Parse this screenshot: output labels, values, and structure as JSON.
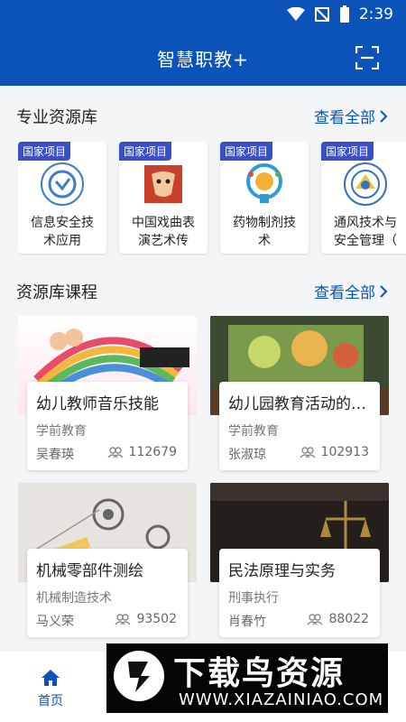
{
  "status": {
    "time": "2:39"
  },
  "header": {
    "title": "智慧职教+"
  },
  "specialty": {
    "title": "专业资源库",
    "see_all": "查看全部",
    "items": [
      {
        "badge": "国家项目",
        "name": "信息安全技术应用（信…",
        "color": "#3d7ec9"
      },
      {
        "badge": "国家项目",
        "name": "中国戏曲表演艺术传承…",
        "color": "#c8412b"
      },
      {
        "badge": "国家项目",
        "name": "药物制剂技术",
        "color": "#2f9bd6"
      },
      {
        "badge": "国家项目",
        "name": "通风技术与安全管理（",
        "color": "#3a6fc0"
      }
    ]
  },
  "courses": {
    "title": "资源库课程",
    "see_all": "查看全部",
    "items": [
      {
        "title": "幼儿教师音乐技能",
        "category": "学前教育",
        "teacher": "吴春瑛",
        "views": "112679",
        "thumb_text": "幼儿教师音乐技能"
      },
      {
        "title": "幼儿园教育活动的设…",
        "category": "学前教育",
        "teacher": "张淑琼",
        "views": "102913",
        "thumb_text": ""
      },
      {
        "title": "机械零部件测绘",
        "category": "机械制造技术",
        "teacher": "马义荣",
        "views": "93502",
        "thumb_text": "机械零部件测绘"
      },
      {
        "title": "民法原理与实务",
        "category": "刑事执行",
        "teacher": "肖春竹",
        "views": "88022",
        "thumb_text": "民法原理与实务"
      }
    ]
  },
  "bottom_nav": {
    "home": "首页"
  },
  "watermark": {
    "text": "下载鸟资源",
    "url": "WWW.XIAZAINIAO.COM"
  }
}
